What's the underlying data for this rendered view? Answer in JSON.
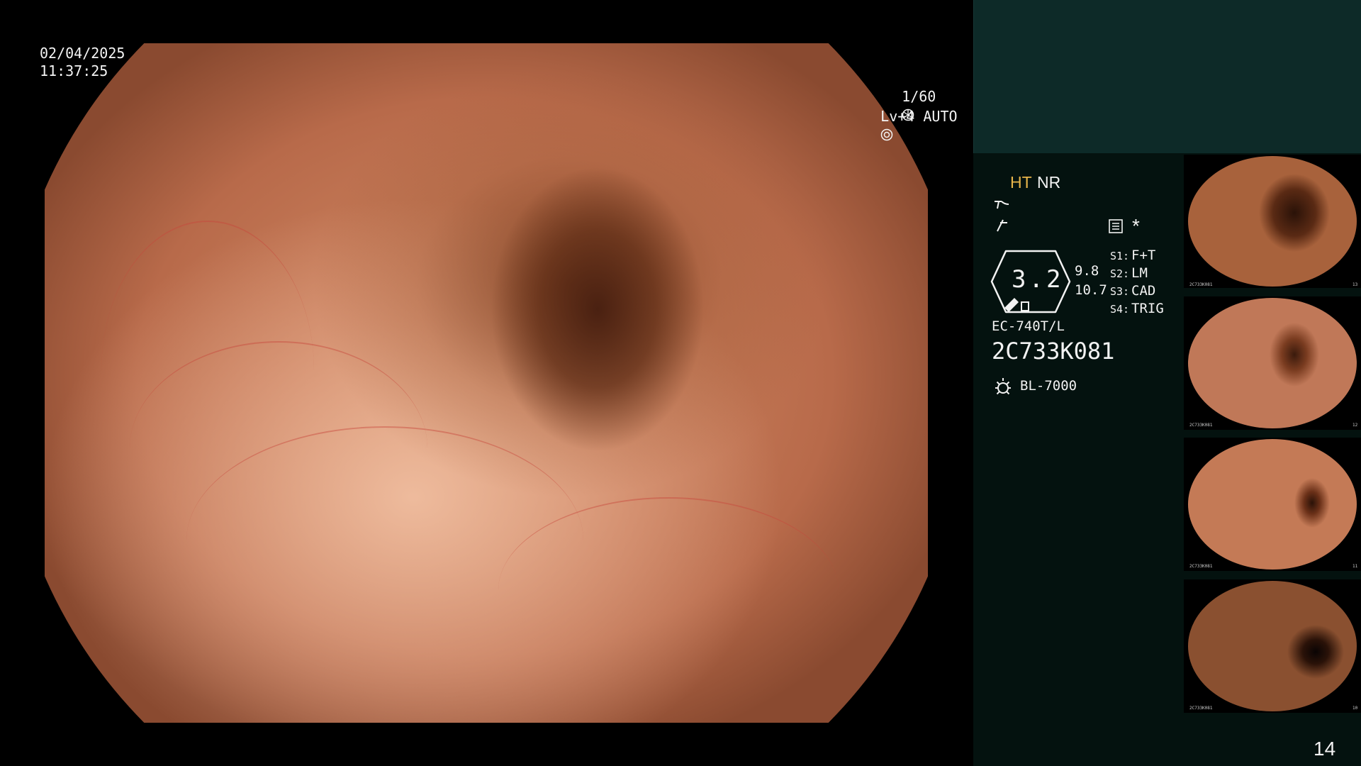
{
  "scope": {
    "date": "02/04/2025",
    "time": "11:37:25",
    "shutter": "1/60",
    "level": "Lv+4 AUTO"
  },
  "settings": {
    "ht": "HT",
    "nr": "NR",
    "zoom_value": "3.2",
    "value_top": "9.8",
    "value_bottom": "10.7",
    "s1_label": "S1:",
    "s1_value": "F+T",
    "s2_label": "S2:",
    "s2_value": "LM",
    "s3_label": "S3:",
    "s3_value": "CAD",
    "s4_label": "S4:",
    "s4_value": "TRIG",
    "scope_model": "EC-740T/L",
    "serial": "2C733K081",
    "light_source": "BL-7000",
    "asterisk": "*"
  },
  "thumbnails": [
    {
      "caption": "2C733K081",
      "index": "13"
    },
    {
      "caption": "2C733K081",
      "index": "12"
    },
    {
      "caption": "2C733K081",
      "index": "11"
    },
    {
      "caption": "2C733K081",
      "index": "10"
    }
  ],
  "page_number": "14",
  "icons": [
    "shutter-icon",
    "auto-iris-icon",
    "structure-enhance-icon",
    "color-enhance-icon",
    "memo-icon",
    "scope-shape-icon",
    "light-source-icon"
  ],
  "colors": {
    "ht": "#e8b54a",
    "sidebar": "#04120f",
    "sidebar_top": "#0d2a28"
  }
}
